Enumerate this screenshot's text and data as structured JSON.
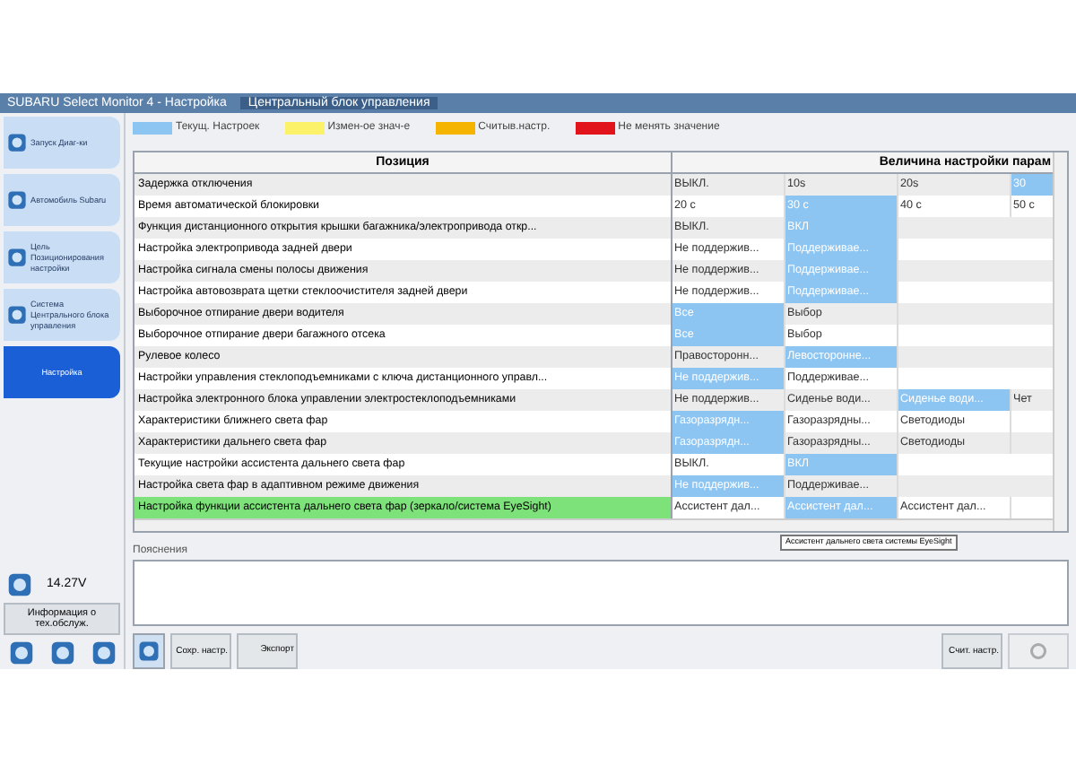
{
  "window": {
    "title": "SUBARU Select Monitor 4 - Настройка",
    "tab": "Центральный блок управления"
  },
  "sidebar": {
    "items": [
      {
        "label": "Запуск Диаг-ки",
        "selected": false
      },
      {
        "label": "Автомобиль Subaru",
        "selected": false
      },
      {
        "label": "Цель Позиционирования настройки",
        "selected": false
      },
      {
        "label": "Система Центрального блока управления",
        "selected": false
      },
      {
        "label": "Настройка",
        "selected": true
      }
    ],
    "voltage": "14.27V",
    "info_button": "Информация о тех.обслуж."
  },
  "legend": [
    {
      "label": "Текущ. Настроек",
      "color": "#8cc4f2"
    },
    {
      "label": "Измен-ое знач-е",
      "color": "#fbf26a"
    },
    {
      "label": "Считыв.настр.",
      "color": "#f5b400"
    },
    {
      "label": "Не менять значение",
      "color": "#e2141b"
    }
  ],
  "table": {
    "position_header": "Позиция",
    "values_header": "Величина настройки парам",
    "rows": [
      {
        "position": "Задержка отключения",
        "selected": false,
        "cells": [
          {
            "text": "ВЫКЛ.",
            "selected": false
          },
          {
            "text": "10s",
            "selected": false
          },
          {
            "text": "20s",
            "selected": false
          },
          {
            "text": "30",
            "selected": true
          }
        ]
      },
      {
        "position": "Время автоматической блокировки",
        "selected": false,
        "cells": [
          {
            "text": "20 с",
            "selected": false
          },
          {
            "text": "30 с",
            "selected": true
          },
          {
            "text": "40 с",
            "selected": false
          },
          {
            "text": "50 с",
            "selected": false
          }
        ]
      },
      {
        "position": "Функция дистанционного открытия крышки багажника/электропривода откр...",
        "selected": false,
        "cells": [
          {
            "text": "ВЫКЛ.",
            "selected": false
          },
          {
            "text": "ВКЛ",
            "selected": true
          }
        ]
      },
      {
        "position": "Настройка электропривода задней двери",
        "selected": false,
        "cells": [
          {
            "text": "Не поддержив...",
            "selected": false
          },
          {
            "text": "Поддерживае...",
            "selected": true
          }
        ]
      },
      {
        "position": "Настройка сигнала смены полосы движения",
        "selected": false,
        "cells": [
          {
            "text": "Не поддержив...",
            "selected": false
          },
          {
            "text": "Поддерживае...",
            "selected": true
          }
        ]
      },
      {
        "position": "Настройка автовозврата щетки стеклоочистителя задней двери",
        "selected": false,
        "cells": [
          {
            "text": "Не поддержив...",
            "selected": false
          },
          {
            "text": "Поддерживае...",
            "selected": true
          }
        ]
      },
      {
        "position": "Выборочное отпирание двери водителя",
        "selected": false,
        "cells": [
          {
            "text": "Все",
            "selected": true
          },
          {
            "text": "Выбор",
            "selected": false
          }
        ]
      },
      {
        "position": "Выборочное отпирание двери багажного отсека",
        "selected": false,
        "cells": [
          {
            "text": "Все",
            "selected": true
          },
          {
            "text": "Выбор",
            "selected": false
          }
        ]
      },
      {
        "position": "Рулевое колесо",
        "selected": false,
        "cells": [
          {
            "text": "Правосторонн...",
            "selected": false
          },
          {
            "text": "Левосторонне...",
            "selected": true
          }
        ]
      },
      {
        "position": "Настройки управления стеклоподъемниками с ключа дистанционного управл...",
        "selected": false,
        "cells": [
          {
            "text": "Не поддержив...",
            "selected": true
          },
          {
            "text": "Поддерживае...",
            "selected": false
          }
        ]
      },
      {
        "position": "Настройка электронного блока управлении электростеклоподъемниками",
        "selected": false,
        "cells": [
          {
            "text": "Не поддержив...",
            "selected": false
          },
          {
            "text": "Сиденье води...",
            "selected": false
          },
          {
            "text": "Сиденье води...",
            "selected": true
          },
          {
            "text": "Чет",
            "selected": false
          }
        ]
      },
      {
        "position": "Характеристики ближнего света фар",
        "selected": false,
        "cells": [
          {
            "text": "Газоразрядн...",
            "selected": true
          },
          {
            "text": "Газоразрядны...",
            "selected": false
          },
          {
            "text": "Светодиоды",
            "selected": false
          }
        ]
      },
      {
        "position": "Характеристики дальнего света фар",
        "selected": false,
        "cells": [
          {
            "text": "Газоразрядн...",
            "selected": true
          },
          {
            "text": "Газоразрядны...",
            "selected": false
          },
          {
            "text": "Светодиоды",
            "selected": false
          }
        ]
      },
      {
        "position": "Текущие настройки ассистента дальнего света фар",
        "selected": false,
        "cells": [
          {
            "text": "ВЫКЛ.",
            "selected": false
          },
          {
            "text": "ВКЛ",
            "selected": true
          }
        ]
      },
      {
        "position": "Настройка света фар в адаптивном режиме движения",
        "selected": false,
        "cells": [
          {
            "text": "Не поддержив...",
            "selected": true
          },
          {
            "text": "Поддерживае...",
            "selected": false
          }
        ]
      },
      {
        "position": "Настройка функции ассистента дальнего света фар (зеркало/система EyeSight)",
        "selected": true,
        "cells": [
          {
            "text": "Ассистент дал...",
            "selected": false
          },
          {
            "text": "Ассистент дал...",
            "selected": true
          },
          {
            "text": "Ассистент дал...",
            "selected": false
          }
        ]
      }
    ]
  },
  "tooltip": "Ассистент дальнего света системы EyeSight",
  "explanation": {
    "label": "Пояснения"
  },
  "toolbar": {
    "save": "Сохр. настр.",
    "export": "Экспорт",
    "read": "Счит. настр."
  }
}
